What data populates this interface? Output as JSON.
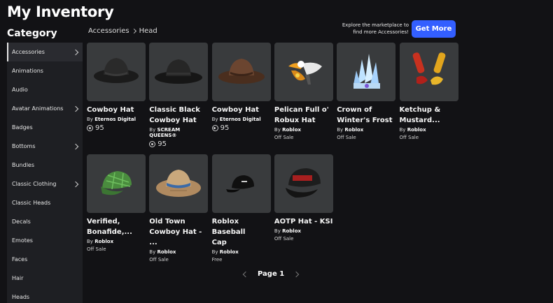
{
  "header": {
    "title": "My Inventory"
  },
  "sidebar": {
    "title": "Category",
    "items": [
      {
        "label": "Accessories",
        "chevron": true,
        "active": true
      },
      {
        "label": "Animations",
        "chevron": false
      },
      {
        "label": "Audio",
        "chevron": false
      },
      {
        "label": "Avatar Animations",
        "chevron": true
      },
      {
        "label": "Badges",
        "chevron": false
      },
      {
        "label": "Bottoms",
        "chevron": true
      },
      {
        "label": "Bundles",
        "chevron": false
      },
      {
        "label": "Classic Clothing",
        "chevron": true
      },
      {
        "label": "Classic Heads",
        "chevron": false
      },
      {
        "label": "Decals",
        "chevron": false
      },
      {
        "label": "Emotes",
        "chevron": false
      },
      {
        "label": "Faces",
        "chevron": false
      },
      {
        "label": "Hair",
        "chevron": false
      },
      {
        "label": "Heads",
        "chevron": false
      }
    ]
  },
  "breadcrumb": [
    "Accessories",
    "Head"
  ],
  "promo": {
    "text": "Explore the marketplace to find more Accessories!",
    "button": "Get More"
  },
  "labels": {
    "by": "By"
  },
  "items": [
    {
      "name": "Cowboy Hat",
      "creator": "Eternos Digital",
      "price": "95",
      "icon": "black-cowboy-hat"
    },
    {
      "name": "Classic Black\nCowboy Hat",
      "creator": "SCREAM QUEENS®",
      "price": "95",
      "icon": "black-cowboy-hat-classic"
    },
    {
      "name": "Cowboy Hat",
      "creator": "Eternos Digital",
      "price": "95",
      "icon": "brown-cowboy-hat"
    },
    {
      "name": "Pelican Full o'\nRobux Hat",
      "creator": "Roblox",
      "status": "Off Sale",
      "icon": "pelican"
    },
    {
      "name": "Crown of\nWinter's Frost",
      "creator": "Roblox",
      "status": "Off Sale",
      "icon": "ice-crown"
    },
    {
      "name": "Ketchup &\nMustard...",
      "creator": "Roblox",
      "status": "Off Sale",
      "icon": "ketchup-mustard"
    },
    {
      "name": "Verified,\nBonafide,...",
      "creator": "Roblox",
      "status": "Off Sale",
      "icon": "green-plaid-cap"
    },
    {
      "name": "Old Town\nCowboy Hat - ...",
      "creator": "Roblox",
      "status": "Off Sale",
      "icon": "straw-cowboy-hat"
    },
    {
      "name": "Roblox Baseball\nCap",
      "creator": "Roblox",
      "status": "Free",
      "icon": "black-baseball-cap"
    },
    {
      "name": "AOTP Hat - KSI",
      "creator": "Roblox",
      "status": "Off Sale",
      "icon": "aotp-cap"
    }
  ],
  "pagination": {
    "label": "Page 1"
  },
  "colors": {
    "accent": "#335fff",
    "background": "#121215",
    "sidebar": "#1e1f23",
    "card": "#393b3d"
  }
}
